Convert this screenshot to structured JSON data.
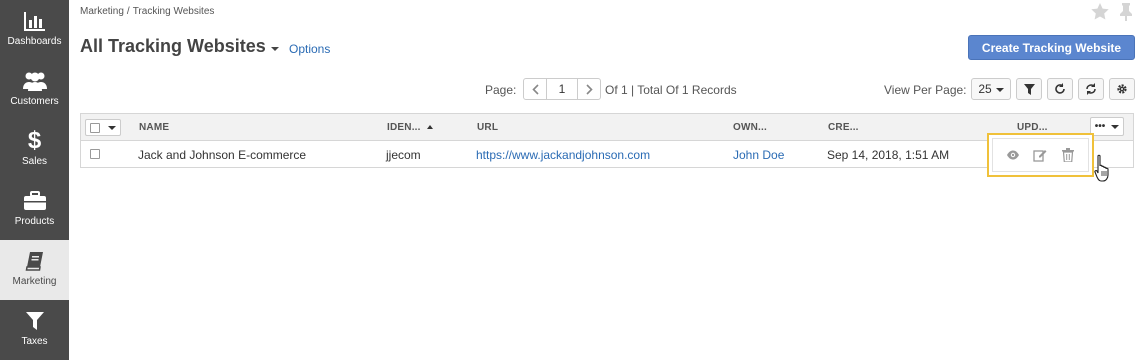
{
  "sidebar": {
    "items": [
      {
        "label": "Dashboards",
        "icon": "bar-chart-icon"
      },
      {
        "label": "Customers",
        "icon": "users-icon"
      },
      {
        "label": "Sales",
        "icon": "dollar-icon"
      },
      {
        "label": "Products",
        "icon": "briefcase-icon"
      },
      {
        "label": "Marketing",
        "icon": "book-icon",
        "active": true
      },
      {
        "label": "Taxes",
        "icon": "funnel-icon"
      }
    ]
  },
  "breadcrumb": {
    "parent": "Marketing",
    "separator": "/",
    "current": "Tracking Websites"
  },
  "header": {
    "title": "All Tracking Websites",
    "options_label": "Options",
    "create_button": "Create Tracking Website"
  },
  "pagination": {
    "page_label": "Page:",
    "current_page": "1",
    "summary": "Of 1 | Total Of 1 Records",
    "view_per_page_label": "View Per Page:",
    "per_page": "25"
  },
  "grid": {
    "columns": [
      "NAME",
      "IDEN...",
      "URL",
      "OWN...",
      "CRE...",
      "UPD..."
    ],
    "more_label": "•••",
    "rows": [
      {
        "name": "Jack and Johnson E-commerce",
        "identifier": "jjecom",
        "url": "https://www.jackandjohnson.com",
        "owner": "John Doe",
        "created": "Sep 14, 2018, 1:51 AM"
      }
    ]
  },
  "colors": {
    "sidebar_bg": "#4a4a4a",
    "primary_button": "#5b86cf",
    "link": "#2a6bb4",
    "highlight": "#f0c13a"
  }
}
